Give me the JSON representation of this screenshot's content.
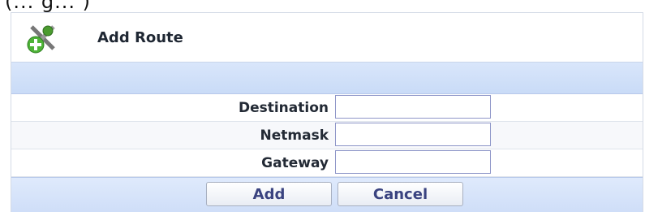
{
  "top_fragment": "(... g... )",
  "dialog": {
    "title": "Add Route",
    "icon": "route-add-icon"
  },
  "fields": [
    {
      "label": "Destination",
      "value": "",
      "placeholder": ""
    },
    {
      "label": "Netmask",
      "value": "",
      "placeholder": ""
    },
    {
      "label": "Gateway",
      "value": "",
      "placeholder": ""
    }
  ],
  "buttons": {
    "add": "Add",
    "cancel": "Cancel"
  },
  "colors": {
    "header_bg": "#ffffff",
    "band_bg": "#d9e6fb",
    "button_text": "#3a4380",
    "input_border": "#8e96c8"
  }
}
